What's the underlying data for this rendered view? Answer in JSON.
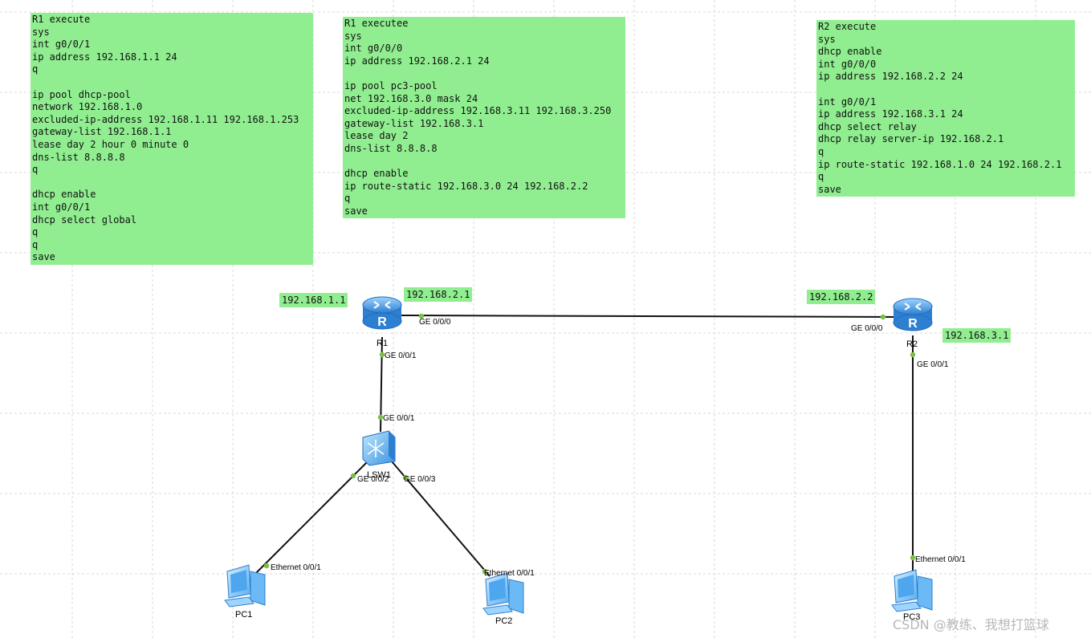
{
  "notes": {
    "r1_left": {
      "lines": [
        "R1 execute",
        "sys",
        "int g0/0/1",
        "ip address 192.168.1.1 24",
        "q",
        "",
        "ip pool dhcp-pool",
        "network 192.168.1.0",
        "excluded-ip-address 192.168.1.11 192.168.1.253",
        "gateway-list 192.168.1.1",
        "lease day 2 hour 0 minute 0",
        "dns-list 8.8.8.8",
        "q",
        "",
        "dhcp enable",
        "int g0/0/1",
        "dhcp select global",
        "q",
        "q",
        "save"
      ]
    },
    "r1_middle": {
      "lines": [
        "R1 executee",
        "sys",
        "int g0/0/0",
        "ip address 192.168.2.1 24",
        "",
        "ip pool pc3-pool",
        "net 192.168.3.0 mask 24",
        "excluded-ip-address 192.168.3.11 192.168.3.250",
        "gateway-list 192.168.3.1",
        "lease day 2",
        "dns-list 8.8.8.8",
        "",
        "dhcp enable",
        "ip route-static 192.168.3.0 24 192.168.2.2",
        "q",
        "save"
      ]
    },
    "r2_right": {
      "lines": [
        "R2 execute",
        "sys",
        "dhcp enable",
        "int g0/0/0",
        "ip address 192.168.2.2 24",
        "",
        "int g0/0/1",
        "ip address 192.168.3.1 24",
        "dhcp select relay",
        "dhcp relay server-ip 192.168.2.1",
        "q",
        "ip route-static 192.168.1.0 24 192.168.2.1",
        "q",
        "save"
      ]
    }
  },
  "ip_labels": {
    "r1_g001": "192.168.1.1",
    "r1_g000": "192.168.2.1",
    "r2_g000": "192.168.2.2",
    "r2_g001": "192.168.3.1"
  },
  "devices": {
    "r1": "R1",
    "r2": "R2",
    "lsw1": "LSW1",
    "pc1": "PC1",
    "pc2": "PC2",
    "pc3": "PC3"
  },
  "ports": {
    "r1_ge000": "GE 0/0/0",
    "r1_ge001": "GE 0/0/1",
    "r2_ge000": "GE 0/0/0",
    "r2_ge001": "GE 0/0/1",
    "lsw1_ge001": "GE 0/0/1",
    "lsw1_ge002": "GE 0/0/2",
    "lsw1_ge003": "GE 0/0/3",
    "pc1_eth": "Ethernet 0/0/1",
    "pc2_eth": "Ethernet 0/0/1",
    "pc3_eth": "Ethernet 0/0/1"
  },
  "colors": {
    "note_bg": "#90ee90",
    "port_dot": "#7ac143",
    "router_blue": "#3a8fd8",
    "grid": "#d9d9d9"
  },
  "watermark": "CSDN @教练、我想打篮球"
}
